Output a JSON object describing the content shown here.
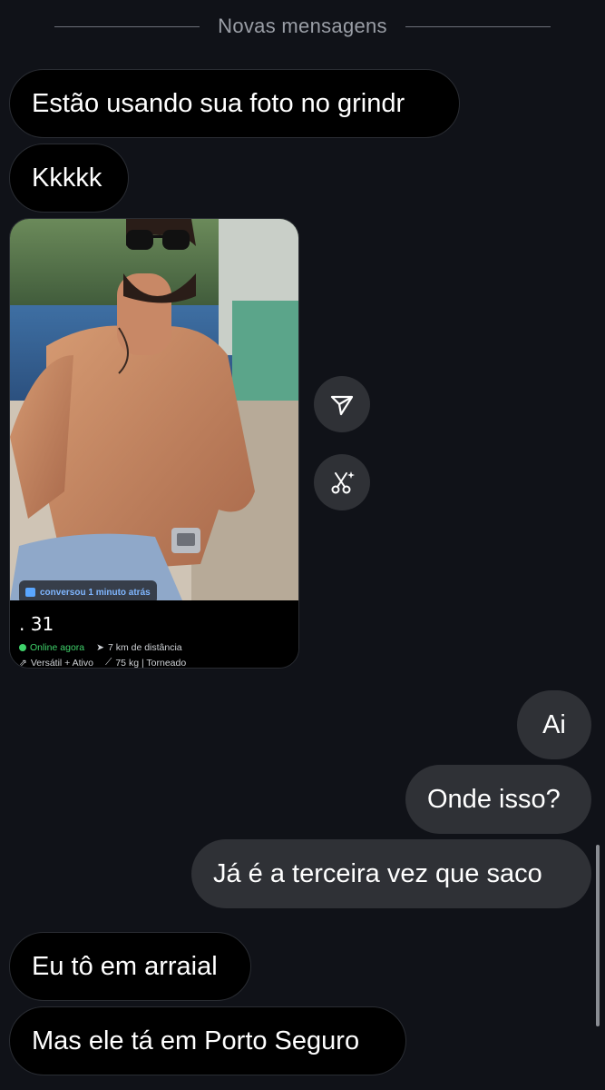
{
  "divider": {
    "label": "Novas mensagens"
  },
  "messages_top": [
    {
      "text": "Estão usando sua foto no grindr"
    },
    {
      "text": "Kkkkk"
    }
  ],
  "profile_card": {
    "chat_status": "conversou 1 minuto atrás",
    "age": ". 31",
    "online": "Online agora",
    "distance": "7 km de distância",
    "position": "Versátil + Ativo",
    "weight": "75 kg | Torneado"
  },
  "actions": {
    "share_icon": "share-paper-plane-icon",
    "edit_icon": "magic-scissors-icon"
  },
  "messages_sent": [
    {
      "text": "Ai"
    },
    {
      "text": "Onde isso?"
    },
    {
      "text": "Já é a terceira vez que saco"
    }
  ],
  "messages_bottom": [
    {
      "text": "Eu tô em arraial"
    },
    {
      "text": "Mas ele tá em Porto Seguro"
    }
  ]
}
